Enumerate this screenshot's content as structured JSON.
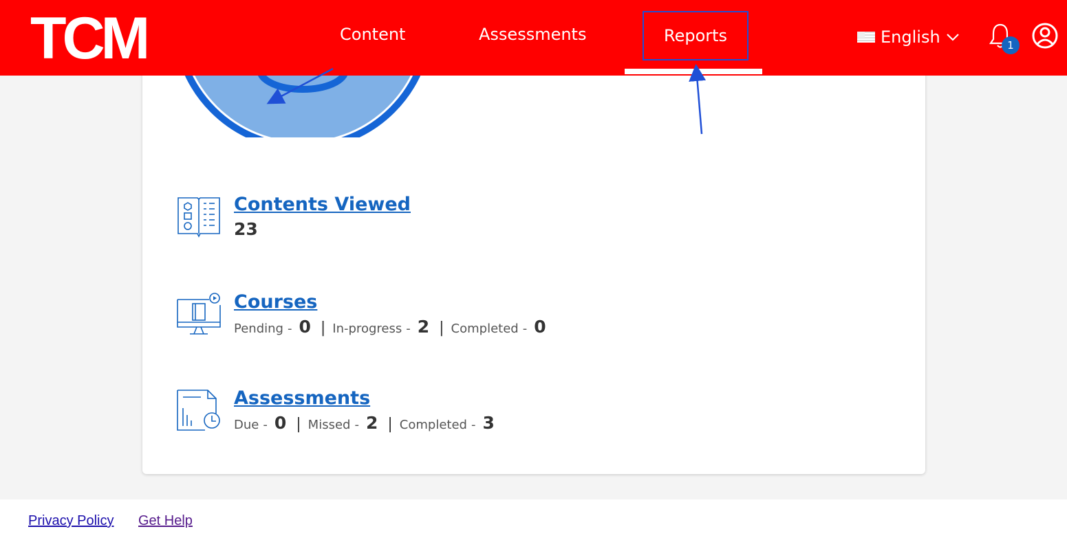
{
  "header": {
    "logo": "TCM",
    "nav": {
      "content": "Content",
      "assessments": "Assessments",
      "reports": "Reports"
    },
    "language": "English",
    "notification_count": "1",
    "colors": {
      "brand": "#ff0000",
      "accent": "#1565c0"
    }
  },
  "stats": {
    "contents_viewed": {
      "title": "Contents Viewed",
      "value": "23"
    },
    "courses": {
      "title": "Courses",
      "pending_label": "Pending",
      "pending": "0",
      "inprogress_label": "In-progress",
      "inprogress": "2",
      "completed_label": "Completed",
      "completed": "0"
    },
    "assessments": {
      "title": "Assessments",
      "due_label": "Due",
      "due": "0",
      "missed_label": "Missed",
      "missed": "2",
      "completed_label": "Completed",
      "completed": "3"
    }
  },
  "footer": {
    "privacy": "Privacy Policy",
    "help": "Get Help"
  }
}
